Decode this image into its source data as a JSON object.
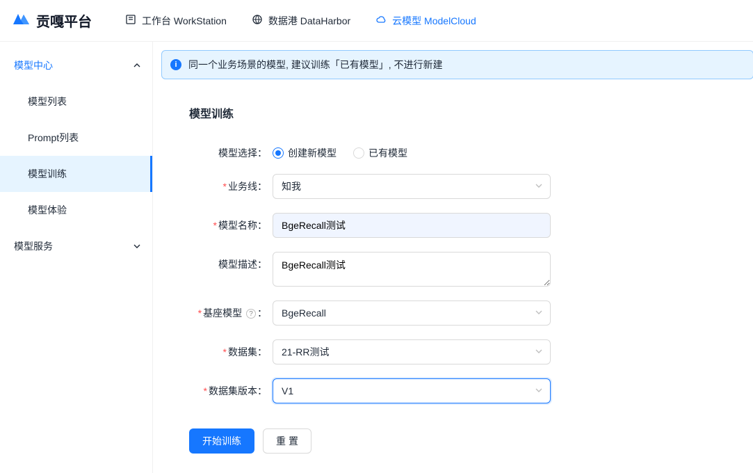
{
  "header": {
    "brand": "贡嘎平台",
    "tabs": [
      {
        "label": "工作台 WorkStation"
      },
      {
        "label": "数据港 DataHarbor"
      },
      {
        "label": "云模型 ModelCloud"
      }
    ]
  },
  "sidebar": {
    "groups": [
      {
        "title": "模型中心",
        "items": [
          {
            "label": "模型列表"
          },
          {
            "label": "Prompt列表"
          },
          {
            "label": "模型训练"
          },
          {
            "label": "模型体验"
          }
        ]
      },
      {
        "title": "模型服务"
      }
    ]
  },
  "alert": {
    "text": "同一个业务场景的模型, 建议训练「已有模型」, 不进行新建"
  },
  "form": {
    "title": "模型训练",
    "labels": {
      "model_choice": "模型选择：",
      "biz_line": "业务线：",
      "model_name": "模型名称：",
      "model_desc": "模型描述：",
      "base_model": "基座模型",
      "base_model_suffix": "：",
      "dataset": "数据集：",
      "dataset_version": "数据集版本："
    },
    "model_choice": {
      "option_new": "创建新模型",
      "option_existing": "已有模型"
    },
    "values": {
      "biz_line": "知我",
      "model_name": "BgeRecall测试",
      "model_desc": "BgeRecall测试",
      "base_model": "BgeRecall",
      "dataset": "21-RR测试",
      "dataset_version": "V1"
    },
    "buttons": {
      "submit": "开始训练",
      "reset": "重置"
    }
  }
}
